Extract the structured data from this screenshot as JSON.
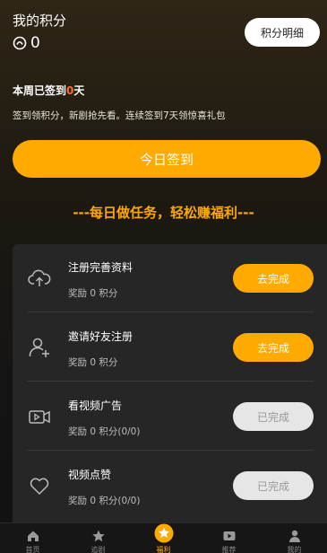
{
  "header": {
    "title": "我的积分",
    "points": "0",
    "detail_button": "积分明细"
  },
  "checkin": {
    "week_prefix": "本周已签到",
    "week_days": "0",
    "week_suffix": "天",
    "description": "签到领积分，新剧抢先看。连续签到7天领惊喜礼包",
    "button_label": "今日签到"
  },
  "slogan": "---每日做任务，轻松赚福利---",
  "tasks": [
    {
      "name": "注册完善资料",
      "reward": "奖励 0 积分",
      "action": "去完成",
      "status": "todo",
      "icon": "cloud-upload-icon"
    },
    {
      "name": "邀请好友注册",
      "reward": "奖励 0 积分",
      "action": "去完成",
      "status": "todo",
      "icon": "add-user-icon"
    },
    {
      "name": "看视频广告",
      "reward": "奖励 0 积分(0/0)",
      "action": "已完成",
      "status": "done",
      "icon": "video-icon"
    },
    {
      "name": "视频点赞",
      "reward": "奖励 0 积分(0/0)",
      "action": "已完成",
      "status": "done",
      "icon": "heart-icon"
    }
  ],
  "tabbar": [
    {
      "label": "首页",
      "icon": "home-icon"
    },
    {
      "label": "追剧",
      "icon": "star-icon"
    },
    {
      "label": "福利",
      "icon": "gift-star-icon",
      "active": true
    },
    {
      "label": "推荐",
      "icon": "play-icon"
    },
    {
      "label": "我的",
      "icon": "user-icon"
    }
  ],
  "colors": {
    "accent": "#ffaa00",
    "highlight": "#ff6a2a",
    "done_button": "#e6e6e6"
  }
}
